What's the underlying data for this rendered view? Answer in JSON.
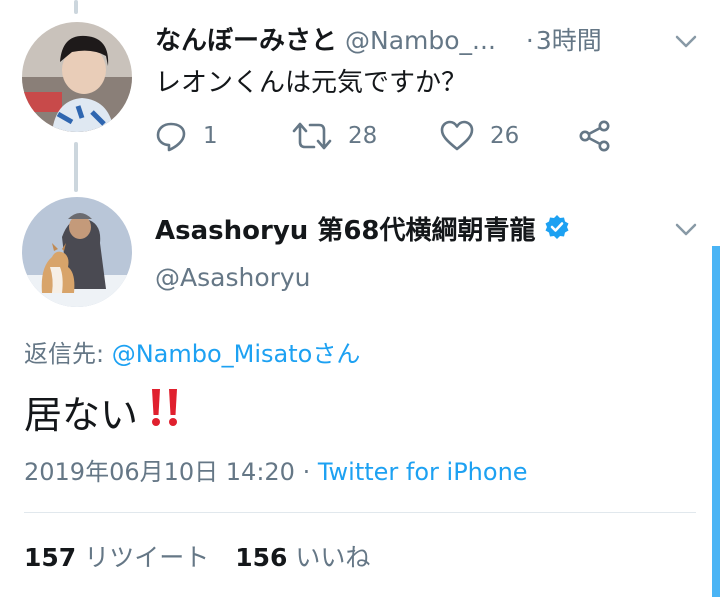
{
  "parent_tweet": {
    "display_name": "なんぼーみさと",
    "handle": "@Nambo_...",
    "dot": "·",
    "time": "3時間",
    "text": "レオンくんは元気ですか？",
    "reply_count": "1",
    "retweet_count": "28",
    "like_count": "26"
  },
  "main_tweet": {
    "display_name": "Asashoryu 第68代横綱朝青龍",
    "handle": "@Asashoryu",
    "reply_to_label": "返信先: ",
    "reply_to_mention": "@Nambo_Misato",
    "reply_to_suffix": "さん",
    "text": "居ない",
    "emoji": "‼️",
    "datetime": "2019年06月10日 14:20",
    "separator": " · ",
    "source": "Twitter for iPhone",
    "retweets": "157",
    "retweets_label": "リツイート",
    "likes": "156",
    "likes_label": "いいね"
  },
  "colors": {
    "accent": "#1da1f2",
    "muted": "#657786",
    "text": "#14171a",
    "emoji_red": "#e0202e"
  }
}
